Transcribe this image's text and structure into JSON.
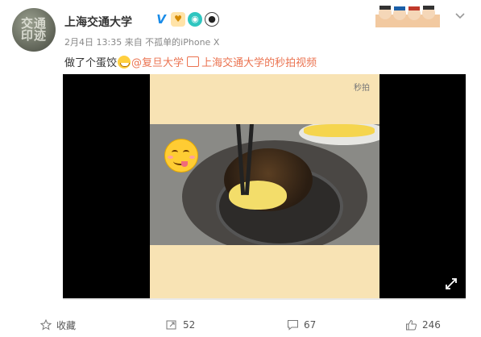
{
  "post": {
    "author": "上海交通大学",
    "meta": "2月4日 13:35 来自 不孤单的iPhone X",
    "text_prefix": "做了个蛋饺",
    "mention": "@复旦大学",
    "video_link": "上海交通大学的秒拍视频",
    "avatar_text": "交通\n印迹"
  },
  "video": {
    "watermark": "秒拍",
    "progress": 0.0
  },
  "actions": {
    "favorite_label": "收藏",
    "repost_count": "52",
    "comment_count": "67",
    "like_count": "246"
  },
  "colors": {
    "link": "#eb7350",
    "verified": "#1a8ce8"
  }
}
